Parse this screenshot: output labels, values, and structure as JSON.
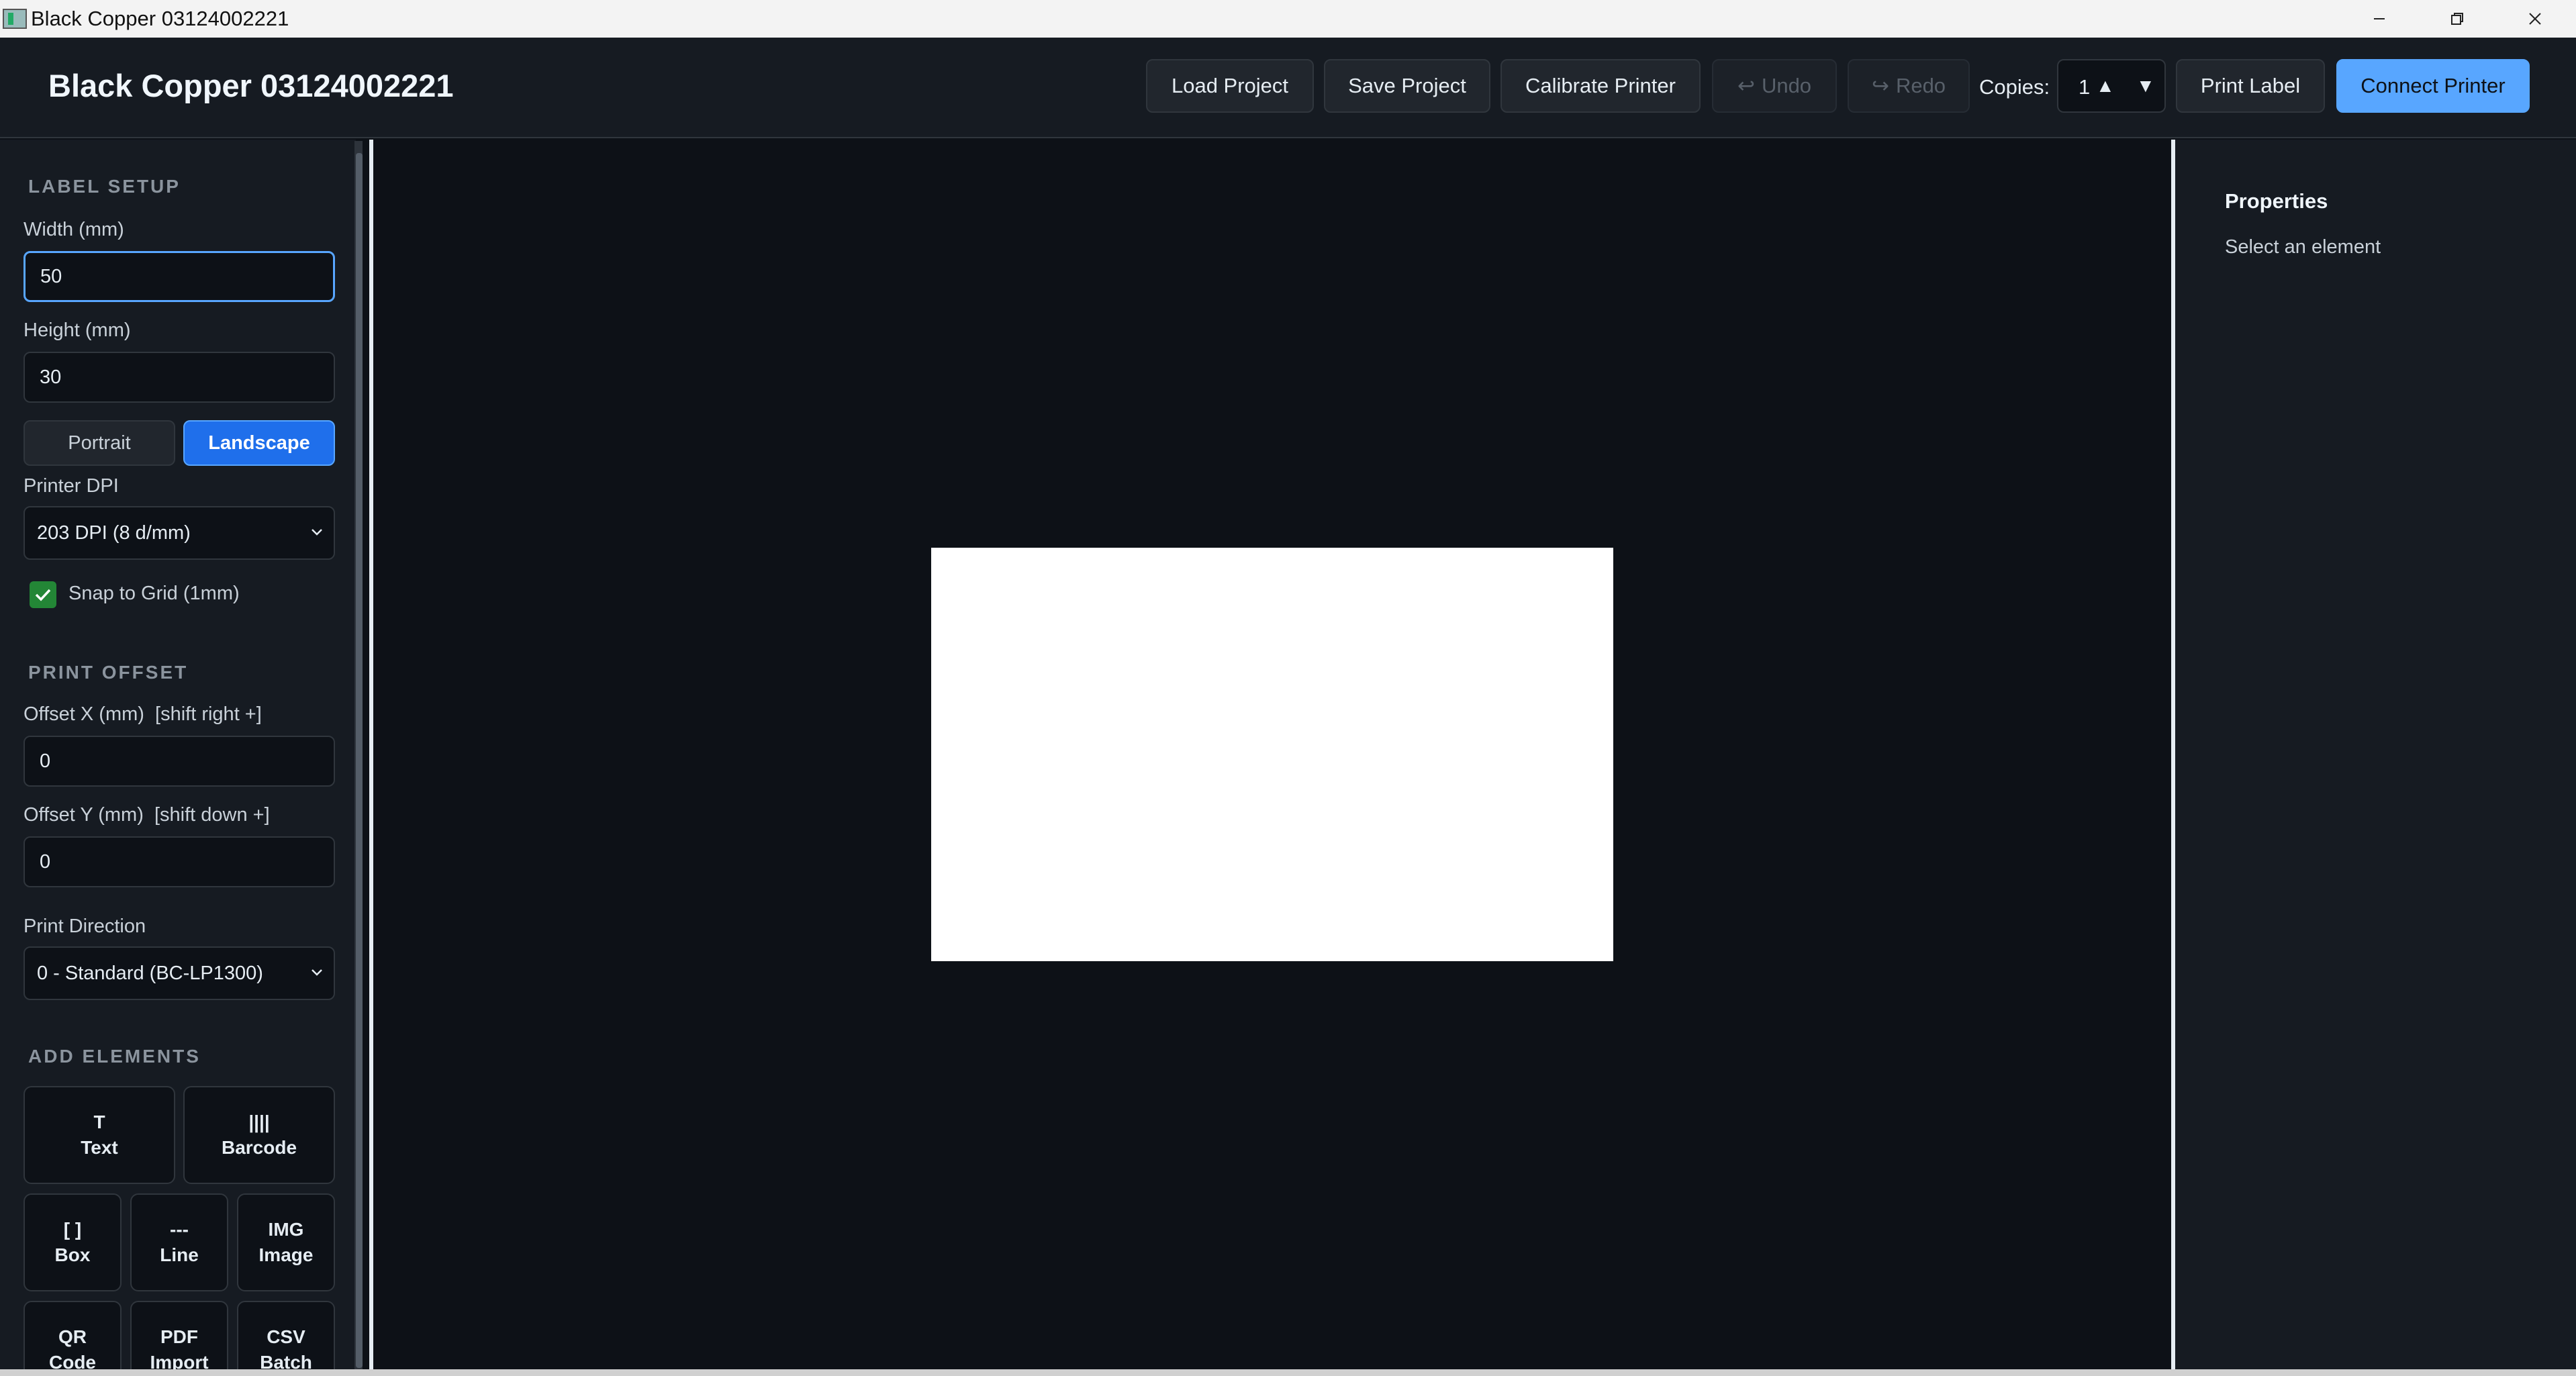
{
  "window": {
    "title": "Black Copper 03124002221"
  },
  "header": {
    "app_title": "Black Copper 03124002221",
    "buttons": {
      "load": "Load Project",
      "save": "Save Project",
      "calibrate": "Calibrate Printer",
      "undo": "Undo",
      "redo": "Redo",
      "print": "Print Label",
      "connect": "Connect Printer"
    },
    "copies_label": "Copies:",
    "copies_value": "1"
  },
  "sidebar": {
    "label_setup": {
      "heading": "LABEL SETUP",
      "width_label": "Width (mm)",
      "width_value": "50",
      "height_label": "Height (mm)",
      "height_value": "30",
      "orientation": {
        "portrait": "Portrait",
        "landscape": "Landscape",
        "selected": "Landscape"
      },
      "dpi_label": "Printer DPI",
      "dpi_value": "203 DPI (8 d/mm)",
      "snap_label": "Snap to Grid (1mm)",
      "snap_checked": true
    },
    "print_offset": {
      "heading": "PRINT OFFSET",
      "offset_x_label": "Offset X (mm)  [shift right +]",
      "offset_x_value": "0",
      "offset_y_label": "Offset Y (mm)  [shift down +]",
      "offset_y_value": "0",
      "direction_label": "Print Direction",
      "direction_value": "0 - Standard (BC-LP1300)"
    },
    "add_elements": {
      "heading": "ADD ELEMENTS",
      "tiles": [
        {
          "glyph": "T",
          "label": "Text"
        },
        {
          "glyph": "||||",
          "label": "Barcode"
        },
        {
          "glyph": "[ ]",
          "label": "Box"
        },
        {
          "glyph": "---",
          "label": "Line"
        },
        {
          "glyph": "IMG",
          "label": "Image"
        },
        {
          "glyph": "QR",
          "label": "Code"
        },
        {
          "glyph": "PDF",
          "label": "Import"
        },
        {
          "glyph": "CSV",
          "label": "Batch"
        }
      ]
    }
  },
  "properties": {
    "title": "Properties",
    "hint": "Select an element"
  },
  "colors": {
    "accent": "#58a6ff",
    "selected": "#1f6feb",
    "check": "#238636",
    "background": "#0d1117",
    "panel": "#161b22"
  }
}
